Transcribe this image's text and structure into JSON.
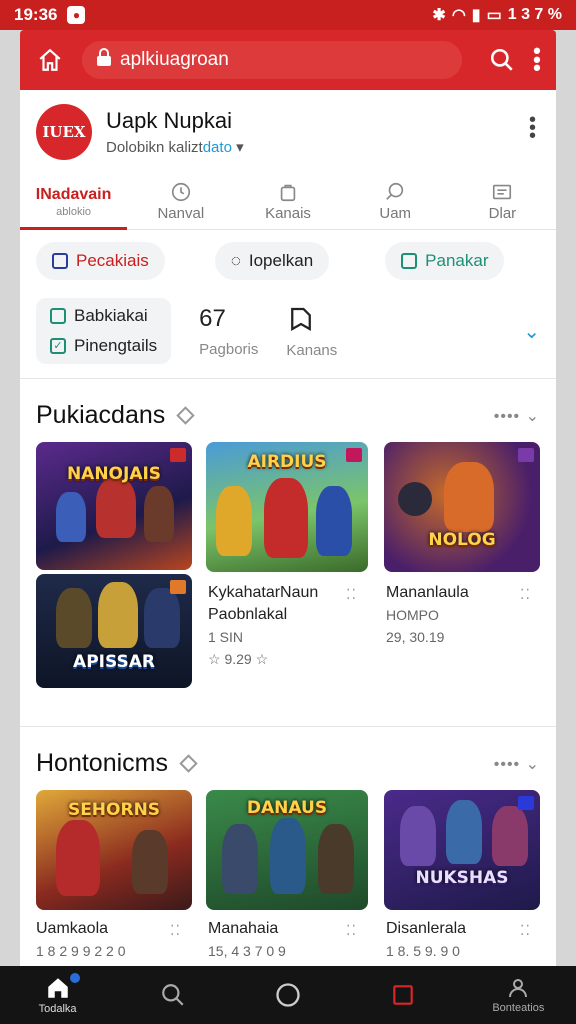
{
  "status": {
    "time": "19:36",
    "right_text": "1 3 7 %"
  },
  "browser": {
    "url": "aplkiuagroan"
  },
  "profile": {
    "name": "Uapk Nupkai",
    "subtitle": "Dolobikn kalizt",
    "subtitle_link": "dato",
    "logo_text": "IUEX"
  },
  "tabs": [
    {
      "top": "INadavain",
      "label": "ablokio",
      "active": true
    },
    {
      "label": "Nanval"
    },
    {
      "label": "Kanais"
    },
    {
      "label": "Uam"
    },
    {
      "label": "Dlar"
    }
  ],
  "chips": {
    "first": "Pecakiais",
    "second": "Iopelkan",
    "third": "Panakar"
  },
  "filters": {
    "opt1": "Babkiakai",
    "opt2": "Pinengtails",
    "stat1_big": "67",
    "stat1_label": "Pagboris",
    "stat2_label": "Kanans"
  },
  "sections": [
    {
      "title": "Pukiacdans",
      "cards": [
        {
          "art": "NANOJAIS"
        },
        {
          "art": "AIRDIUS"
        },
        {
          "art": "NOLOG"
        },
        {
          "art": "APISSAR"
        }
      ],
      "meta": [
        {
          "title": "KykahatarNaun",
          "title2": "Paobnlakal",
          "line": "1 SIN",
          "rating": "☆ 9.29 ☆"
        },
        {
          "title": "Mananlaula",
          "line": "HOMPO",
          "line2": "29, 30.19"
        }
      ]
    },
    {
      "title": "Hontonicms",
      "cards": [
        {
          "art": "SEHORNS"
        },
        {
          "art": "DANAUS"
        },
        {
          "art": "NUKSHAS"
        }
      ],
      "meta": [
        {
          "title": "Uamkaola",
          "line": "1 8 2 9 9 2 2 0"
        },
        {
          "title": "Manahaia",
          "line": "15, 4 3 7 0 9"
        },
        {
          "title": "Disanlerala",
          "line": "1 8. 5 9. 9 0"
        }
      ]
    }
  ],
  "bottom_nav": {
    "home": "Todalka",
    "profile": "Bonteatios"
  },
  "colors": {
    "brand": "#c8201f",
    "accent_blue": "#1d9ad6",
    "accent_teal": "#1e8f77"
  }
}
